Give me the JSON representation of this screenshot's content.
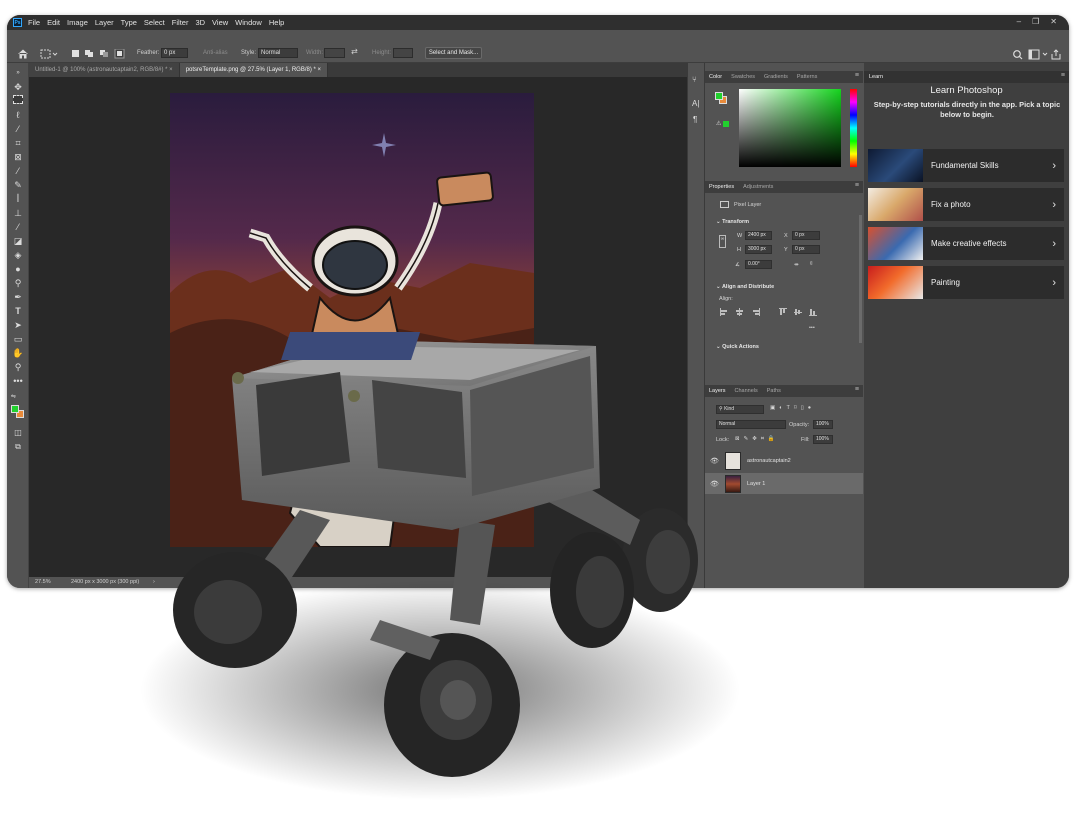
{
  "menu": [
    "File",
    "Edit",
    "Image",
    "Layer",
    "Type",
    "Select",
    "Filter",
    "3D",
    "View",
    "Window",
    "Help"
  ],
  "window_controls": [
    "–",
    "❐",
    "✕"
  ],
  "options": {
    "feather_label": "Feather:",
    "feather_value": "0 px",
    "antialias_label": "Anti-alias",
    "style_label": "Style:",
    "style_value": "Normal",
    "width_label": "Width:",
    "height_label": "Height:",
    "select_mask": "Select and Mask..."
  },
  "tabs": [
    {
      "label": "Untitled-1 @ 100% (astronautcaptain2, RGB/8#) *",
      "close": "×"
    },
    {
      "label": "potsreTemplate.png @ 27.5% (Layer 1, RGB/8) *",
      "close": "×"
    }
  ],
  "status": {
    "zoom": "27.5%",
    "doc_info": "2400 px x 3000 px (300 ppi)",
    "arrow": "›"
  },
  "color_panel": {
    "tabs": [
      "Color",
      "Swatches",
      "Gradients",
      "Patterns"
    ],
    "fg": "#22d12e",
    "bg": "#e88a3a"
  },
  "properties": {
    "tabs": [
      "Properties",
      "Adjustments"
    ],
    "layer_type": "Pixel Layer",
    "transform": "Transform",
    "w_label": "W",
    "w": "2400 px",
    "h_label": "H",
    "h": "3000 px",
    "x_label": "X",
    "x": "0 px",
    "y_label": "Y",
    "y": "0 px",
    "angle": "0.00°",
    "align": "Align and Distribute",
    "align_label": "Align:",
    "more": "•••",
    "quick": "Quick Actions"
  },
  "layers": {
    "tabs": [
      "Layers",
      "Channels",
      "Paths"
    ],
    "kind": "Kind",
    "blend": "Normal",
    "opacity_label": "Opacity:",
    "opacity": "100%",
    "lock_label": "Lock:",
    "fill_label": "Fill:",
    "fill": "100%",
    "items": [
      {
        "name": "astronautcaptain2",
        "selected": false
      },
      {
        "name": "Layer 1",
        "selected": true
      }
    ]
  },
  "learn": {
    "tab": "Learn",
    "title": "Learn Photoshop",
    "subtitle": "Step-by-step tutorials directly in the app. Pick a topic below to begin.",
    "cards": [
      "Fundamental Skills",
      "Fix a photo",
      "Make creative effects",
      "Painting"
    ],
    "chevron": "›"
  }
}
